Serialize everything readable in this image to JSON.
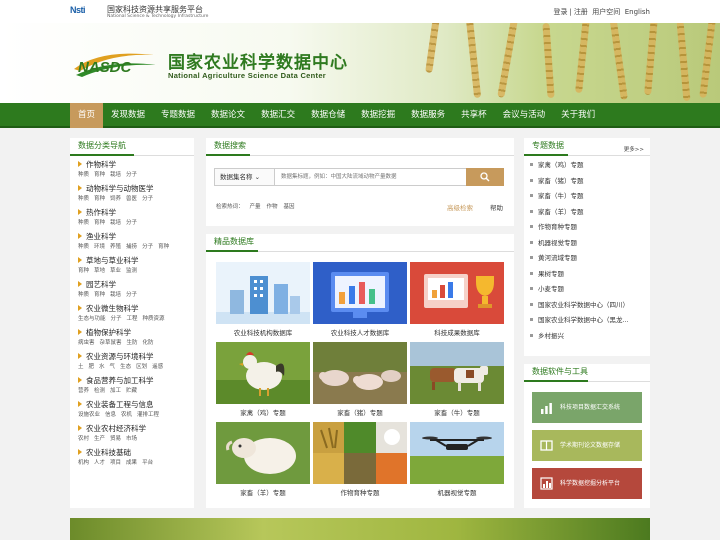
{
  "top": {
    "org_cn": "国家科技资源共享服务平台",
    "org_en": "National Science & Technology Infrastructure",
    "org_mark": "Nsti",
    "links": [
      "登录",
      "注册",
      "用户空间",
      "English"
    ]
  },
  "banner": {
    "logo_text": "NASDC",
    "title_cn": "国家农业科学数据中心",
    "title_en": "National Agriculture Science Data Center"
  },
  "nav": [
    "首页",
    "发现数据",
    "专题数据",
    "数据论文",
    "数据汇交",
    "数据仓储",
    "数据挖掘",
    "数据服务",
    "共享杯",
    "会议与活动",
    "关于我们"
  ],
  "left": {
    "title": "数据分类导航",
    "categories": [
      {
        "name": "作物科学",
        "subs": [
          "种质",
          "育种",
          "栽培",
          "分子"
        ]
      },
      {
        "name": "动物科学与动物医学",
        "subs": [
          "种质",
          "育种",
          "饲养",
          "兽医",
          "分子"
        ]
      },
      {
        "name": "热作科学",
        "subs": [
          "种质",
          "育种",
          "栽培",
          "分子"
        ]
      },
      {
        "name": "渔业科学",
        "subs": [
          "种质",
          "环境",
          "养殖",
          "捕捞",
          "分子",
          "育种"
        ]
      },
      {
        "name": "草地与草业科学",
        "subs": [
          "育种",
          "草地",
          "草业",
          "监测"
        ]
      },
      {
        "name": "园艺科学",
        "subs": [
          "种质",
          "育种",
          "栽培",
          "分子"
        ]
      },
      {
        "name": "农业微生物科学",
        "subs": [
          "生态与功能",
          "分子",
          "工程",
          "种质资源"
        ]
      },
      {
        "name": "植物保护科学",
        "subs": [
          "病虫害",
          "杂草鼠害",
          "生防",
          "化防"
        ]
      },
      {
        "name": "农业资源与环境科学",
        "subs": [
          "土",
          "肥",
          "水",
          "气",
          "生态",
          "区划",
          "遥感"
        ]
      },
      {
        "name": "食品营养与加工科学",
        "subs": [
          "营养",
          "检测",
          "加工",
          "贮藏"
        ]
      },
      {
        "name": "农业装备工程与信息",
        "subs": [
          "设施农业",
          "信息",
          "农机",
          "灌排工程"
        ]
      },
      {
        "name": "农业农村经济科学",
        "subs": [
          "农村",
          "生产",
          "贸易",
          "市场"
        ]
      },
      {
        "name": "农业科技基础",
        "subs": [
          "机构",
          "人才",
          "项目",
          "成果",
          "平台"
        ]
      }
    ]
  },
  "search": {
    "title": "数据搜索",
    "type": "数据集名称",
    "placeholder": "数据集标题，例如：中国大陆流域动物产量数据",
    "hot_label": "检索热词：",
    "hot": [
      "产量",
      "作物",
      "基因"
    ],
    "advanced": "高级检索",
    "help": "帮助"
  },
  "premium": {
    "title": "精品数据库",
    "items": [
      "农业科技机构数据库",
      "农业科技人才数据库",
      "科技成果数据库",
      "家禽（鸡）专题",
      "家畜（猪）专题",
      "家畜（牛）专题",
      "家畜（羊）专题",
      "作物育种专题",
      "机器视觉专题"
    ]
  },
  "topics": {
    "title": "专题数据",
    "more": "更多>>",
    "items": [
      "家禽（鸡）专题",
      "家畜（猪）专题",
      "家畜（牛）专题",
      "家畜（羊）专题",
      "作物育种专题",
      "机器视觉专题",
      "黄河流域专题",
      "果树专题",
      "小麦专题",
      "国家农业科学数据中心（四川）",
      "国家农业科学数据中心（黑龙...",
      "乡村振兴"
    ]
  },
  "tools": {
    "title": "数据软件与工具",
    "items": [
      {
        "label": "科技项目数据汇交系统",
        "color": "#7aa56a"
      },
      {
        "label": "学术期刊论文数据存储",
        "color": "#a8b85c"
      },
      {
        "label": "科学数据挖掘分析平台",
        "color": "#b5483c"
      }
    ]
  },
  "colors": {
    "nav": "#2d7a1e",
    "accent": "#c79a5c",
    "green": "#2f7a20"
  }
}
